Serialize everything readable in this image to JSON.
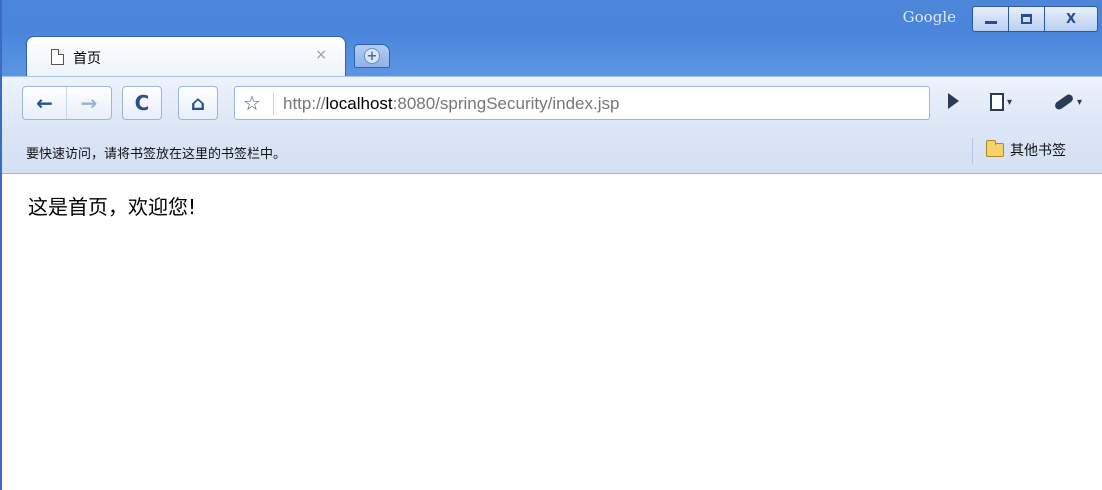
{
  "window": {
    "brand": "Google",
    "controls": {
      "close": "X"
    }
  },
  "tab": {
    "title": "首页",
    "close": "×",
    "new_tab": "+"
  },
  "toolbar": {
    "back": "←",
    "forward": "→",
    "reload": "C",
    "home": "⌂",
    "star": "☆",
    "url_scheme": "http://",
    "url_host": "localhost",
    "url_rest": ":8080/springSecurity/index.jsp",
    "go": "▶",
    "menu_caret": "▾"
  },
  "bookmarks": {
    "hint": "要快速访问，请将书签放在这里的书签栏中。",
    "other_bookmarks": "其他书签"
  },
  "content": {
    "text": "这是首页，欢迎您!"
  }
}
